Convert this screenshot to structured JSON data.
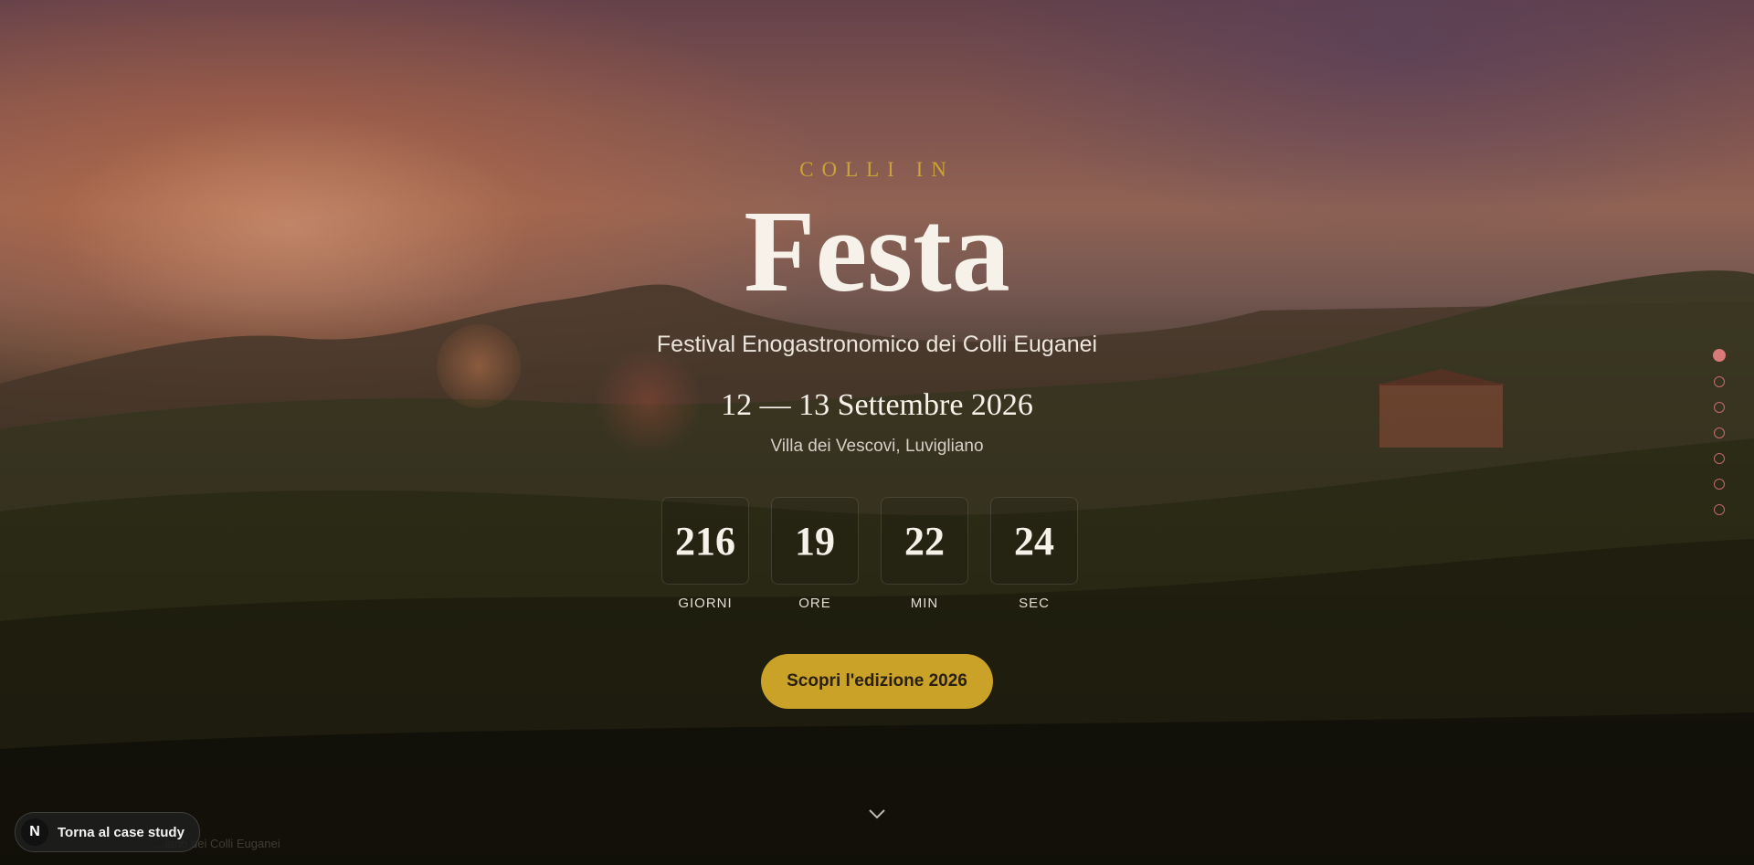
{
  "hero": {
    "eyebrow": "COLLI IN",
    "title": "Festa",
    "subtitle": "Festival Enogastronomico dei Colli Euganei",
    "dates": "12 — 13 Settembre 2026",
    "venue": "Villa dei Vescovi, Luvigliano"
  },
  "countdown": [
    {
      "value": "216",
      "label": "GIORNI"
    },
    {
      "value": "19",
      "label": "ORE"
    },
    {
      "value": "22",
      "label": "MIN"
    },
    {
      "value": "24",
      "label": "SEC"
    }
  ],
  "cta": {
    "label": "Scopri l'edizione 2026"
  },
  "section_nav": {
    "count": 7,
    "active_index": 0
  },
  "case_study_button": {
    "logo": "N",
    "label": "Torna al case study"
  },
  "footnote": "...iano dei Colli Euganei",
  "colors": {
    "accent_gold": "#c9a227",
    "nav_dot": "#d87a7a"
  },
  "icons": {
    "scroll": "chevron-down-icon"
  }
}
